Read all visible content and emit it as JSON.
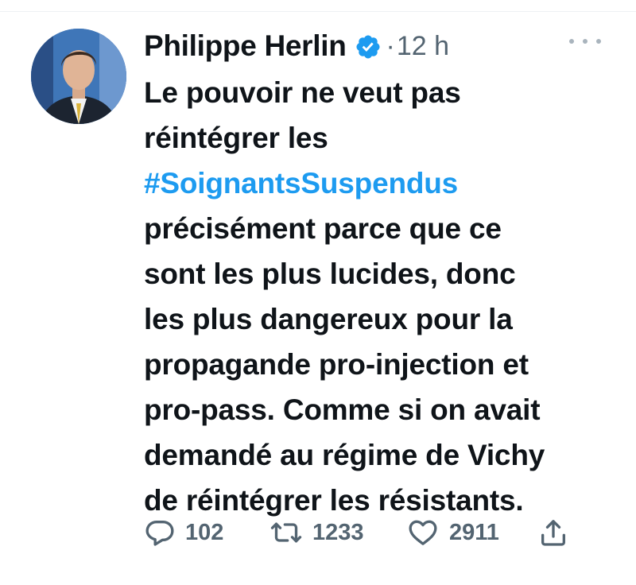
{
  "tweet": {
    "author_name": "Philippe Herlin",
    "separator": "·",
    "timestamp": "12 h",
    "text_lines": [
      "Le pouvoir ne veut pas",
      "réintégrer les",
      "#SoignantsSuspendus",
      "précisément parce que ce",
      "sont les plus lucides, donc",
      "les plus dangereux pour la",
      "propagande pro-injection et",
      "pro-pass. Comme si on avait",
      "demandé au régime de Vichy",
      "de réintégrer les résistants."
    ],
    "hashtag_line_index": 2
  },
  "actions": {
    "reply_count": "102",
    "retweet_count": "1233",
    "like_count": "2911"
  },
  "icons": {
    "verified": "verified-badge-icon",
    "more": "more-options-icon",
    "reply": "reply-icon",
    "retweet": "retweet-icon",
    "like": "heart-icon",
    "share": "share-icon"
  },
  "colors": {
    "text": "#0f1419",
    "secondary": "#536471",
    "accent": "#1d9bf0"
  }
}
